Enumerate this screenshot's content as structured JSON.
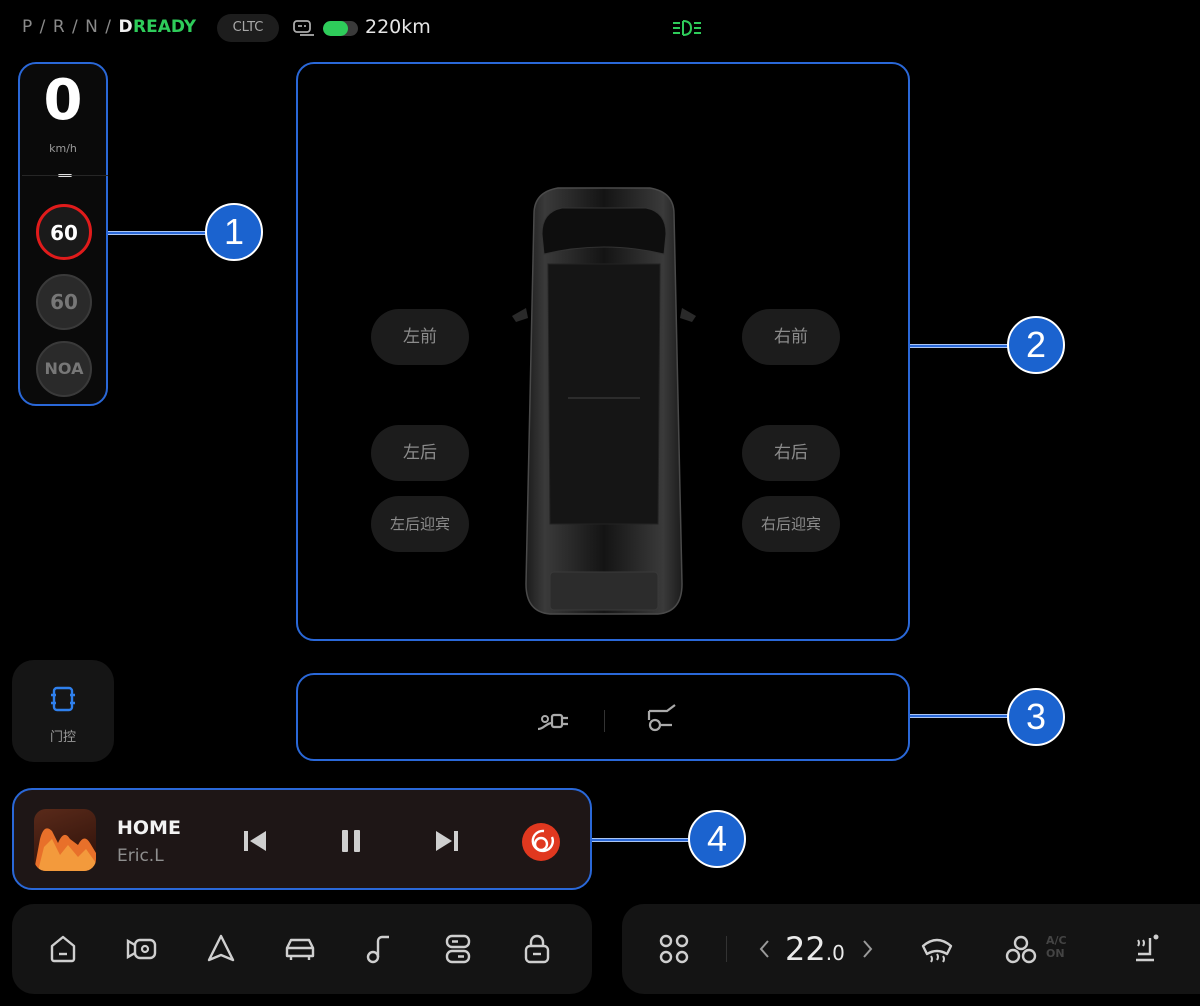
{
  "status_bar": {
    "gears": [
      "P",
      "R",
      "N",
      "D"
    ],
    "active_gear": "D",
    "ready_label": "READY",
    "range_standard": "CLTC",
    "battery_level": 0.7,
    "range": "220km",
    "colors": {
      "ready": "#2ecc5a",
      "lamp": "#2ecc5a"
    }
  },
  "speed_panel": {
    "speed": "0",
    "unit": "km/h",
    "speed_limit": "60",
    "cruise_speed": "60",
    "noa_label": "NOA",
    "colors": {
      "limit_ring": "#e01b1b"
    }
  },
  "doors": {
    "front_left": "左前",
    "front_right": "右前",
    "rear_left": "左后",
    "rear_right": "右后",
    "rear_left_welcome": "左后迎宾",
    "rear_right_welcome": "右后迎宾"
  },
  "charge_panel": {
    "icons": [
      "charge-port-icon",
      "charge-cover-icon"
    ]
  },
  "door_control": {
    "label": "门控",
    "icon": "door-control-icon"
  },
  "media": {
    "title": "HOME",
    "artist": "Eric.L",
    "controls": [
      "previous-icon",
      "pause-icon",
      "next-icon"
    ],
    "app_icon": "netease-music-icon",
    "colors": {
      "app": "#e0381f"
    }
  },
  "dock": {
    "icons": [
      "home-icon",
      "camera-icon",
      "navigation-icon",
      "vehicle-icon",
      "music-icon",
      "toggle-icon",
      "lock-icon"
    ]
  },
  "climate": {
    "temperature_whole": "22",
    "temperature_decimal": ".0",
    "icons": [
      "apps-icon",
      "decrease-chevron-icon",
      "increase-chevron-icon",
      "defrost-icon",
      "fan-icon",
      "seat-heat-icon"
    ],
    "ac_label_top": "A/C",
    "ac_label_bottom": "ON"
  },
  "callouts": [
    "1",
    "2",
    "3",
    "4"
  ],
  "colors": {
    "highlight": "#2a68d8",
    "callout": "#1b63cf"
  }
}
